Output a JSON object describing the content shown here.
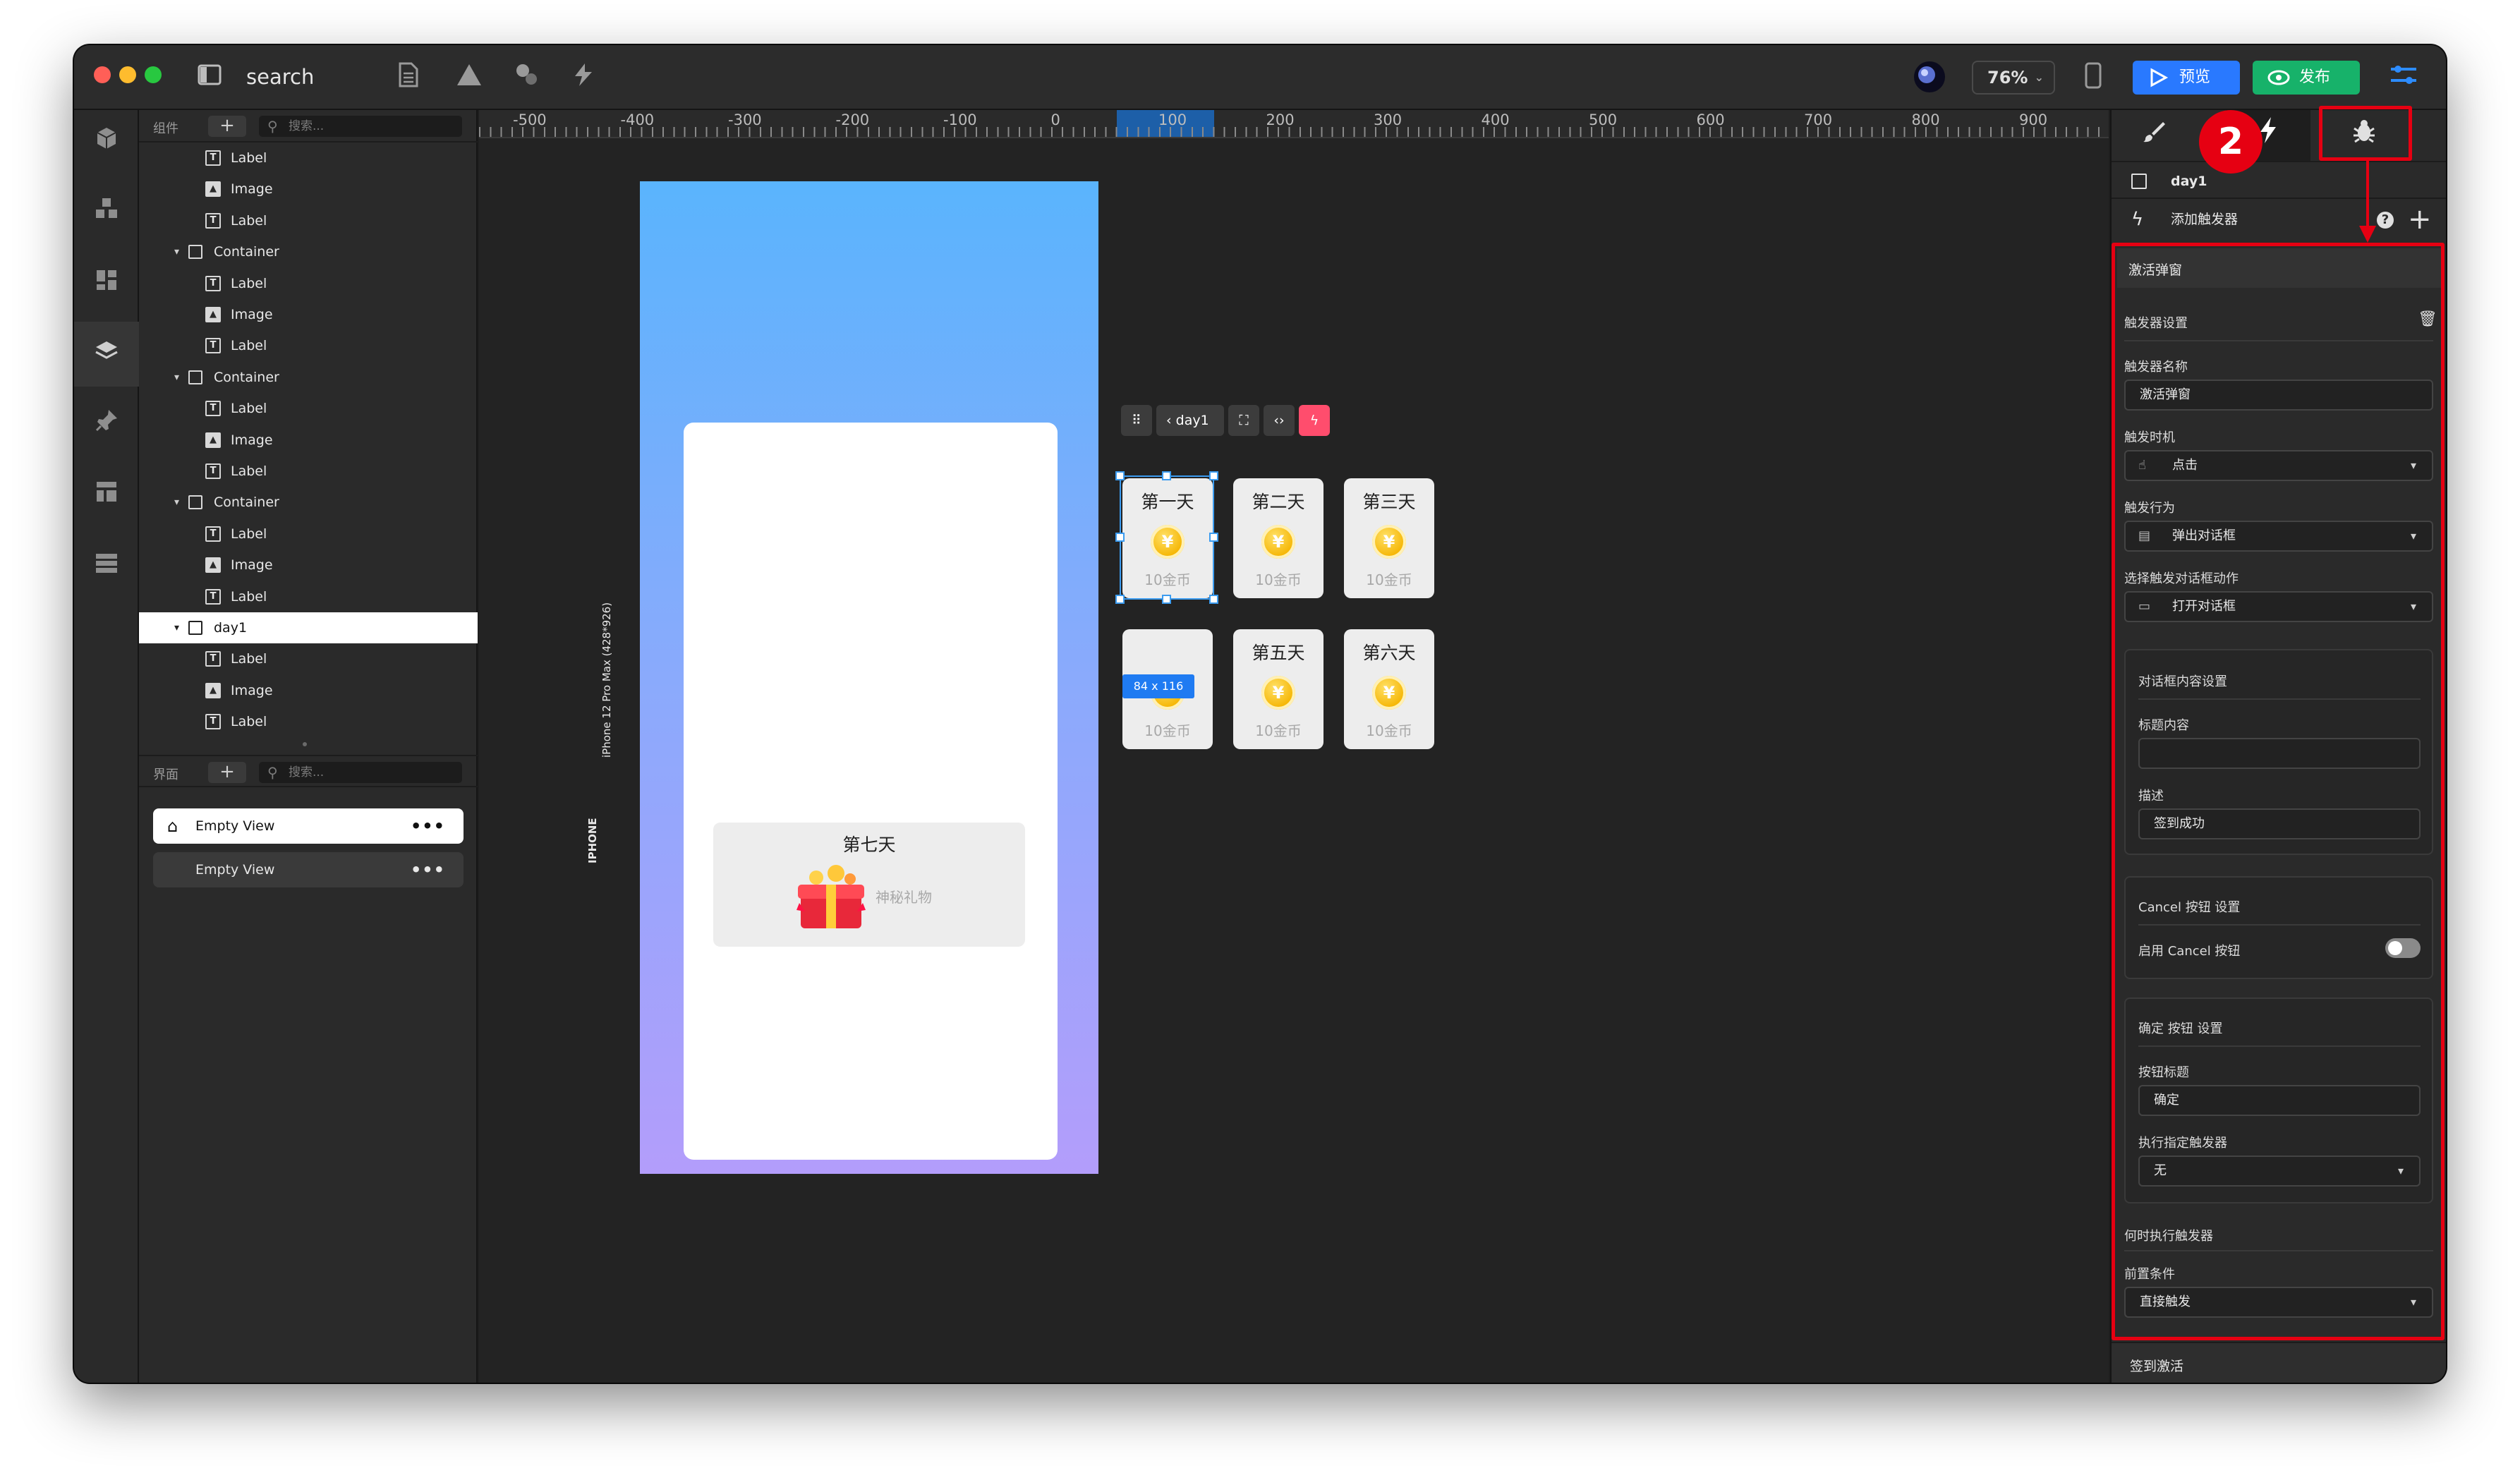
{
  "window": {
    "title": "search"
  },
  "toolbar": {
    "zoom": "76%",
    "preview_label": "预览",
    "publish_label": "发布"
  },
  "components_panel": {
    "header": "组件",
    "search_placeholder": "搜索...",
    "items": [
      {
        "type": "Label",
        "label": "Label"
      },
      {
        "type": "Image",
        "label": "Image"
      },
      {
        "type": "Label",
        "label": "Label"
      },
      {
        "type": "Container",
        "label": "Container"
      },
      {
        "type": "Label",
        "label": "Label"
      },
      {
        "type": "Image",
        "label": "Image"
      },
      {
        "type": "Label",
        "label": "Label"
      },
      {
        "type": "Container",
        "label": "Container"
      },
      {
        "type": "Label",
        "label": "Label"
      },
      {
        "type": "Image",
        "label": "Image"
      },
      {
        "type": "Label",
        "label": "Label"
      },
      {
        "type": "Container",
        "label": "Container"
      },
      {
        "type": "Label",
        "label": "Label"
      },
      {
        "type": "Image",
        "label": "Image"
      },
      {
        "type": "Label",
        "label": "Label"
      },
      {
        "type": "Container",
        "label": "day1",
        "selected": true
      },
      {
        "type": "Label",
        "label": "Label"
      },
      {
        "type": "Image",
        "label": "Image"
      },
      {
        "type": "Label",
        "label": "Label"
      }
    ]
  },
  "views_panel": {
    "header": "界面",
    "search_placeholder": "搜索...",
    "items": [
      {
        "label": "Empty View",
        "home": true,
        "active": true
      },
      {
        "label": "Empty View",
        "home": false,
        "active": false
      }
    ]
  },
  "ruler": {
    "labels": [
      "-500",
      "-400",
      "-300",
      "-200",
      "-100",
      "0",
      "100",
      "200",
      "300",
      "400",
      "500",
      "600",
      "700",
      "800",
      "900"
    ]
  },
  "device": {
    "name": "IPHONE",
    "model": "iPhone 12 Pro Max (428*926)"
  },
  "canvas_toolbar": {
    "back_label": "day1"
  },
  "selection": {
    "dims": "84 x 116"
  },
  "checkin": {
    "days": [
      {
        "name": "第一天",
        "reward": "10金币"
      },
      {
        "name": "第二天",
        "reward": "10金币"
      },
      {
        "name": "第三天",
        "reward": "10金币"
      },
      {
        "name": "",
        "reward": "10金币"
      },
      {
        "name": "第五天",
        "reward": "10金币"
      },
      {
        "name": "第六天",
        "reward": "10金币"
      }
    ],
    "coin_symbol": "¥",
    "day7": {
      "name": "第七天",
      "reward": "神秘礼物"
    }
  },
  "inspector": {
    "step_badge": "2",
    "selected_name": "day1",
    "add_trigger": "添加触发器",
    "trigger_title": "激活弹窗",
    "trigger_settings": "触发器设置",
    "name_label": "触发器名称",
    "name_value": "激活弹窗",
    "timing_label": "触发时机",
    "timing_value": "点击",
    "behavior_label": "触发行为",
    "behavior_value": "弹出对话框",
    "action_label": "选择触发对话框动作",
    "action_value": "打开对话框",
    "dialog_settings": "对话框内容设置",
    "title_content_label": "标题内容",
    "title_content_value": "",
    "desc_label": "描述",
    "desc_value": "签到成功",
    "cancel_settings": "Cancel 按钮 设置",
    "cancel_enable": "启用 Cancel 按钮",
    "cancel_enabled": false,
    "confirm_settings": "确定 按钮 设置",
    "button_title_label": "按钮标题",
    "button_title_value": "确定",
    "exec_trigger_label": "执行指定触发器",
    "exec_trigger_value": "无",
    "when_label": "何时执行触发器",
    "precondition_label": "前置条件",
    "precondition_value": "直接触发",
    "next_trigger": "签到激活"
  },
  "colors": {
    "accent": "#2979ff",
    "publish": "#17b26a",
    "annotation": "#e60012",
    "selection": "#3c9cf0"
  }
}
